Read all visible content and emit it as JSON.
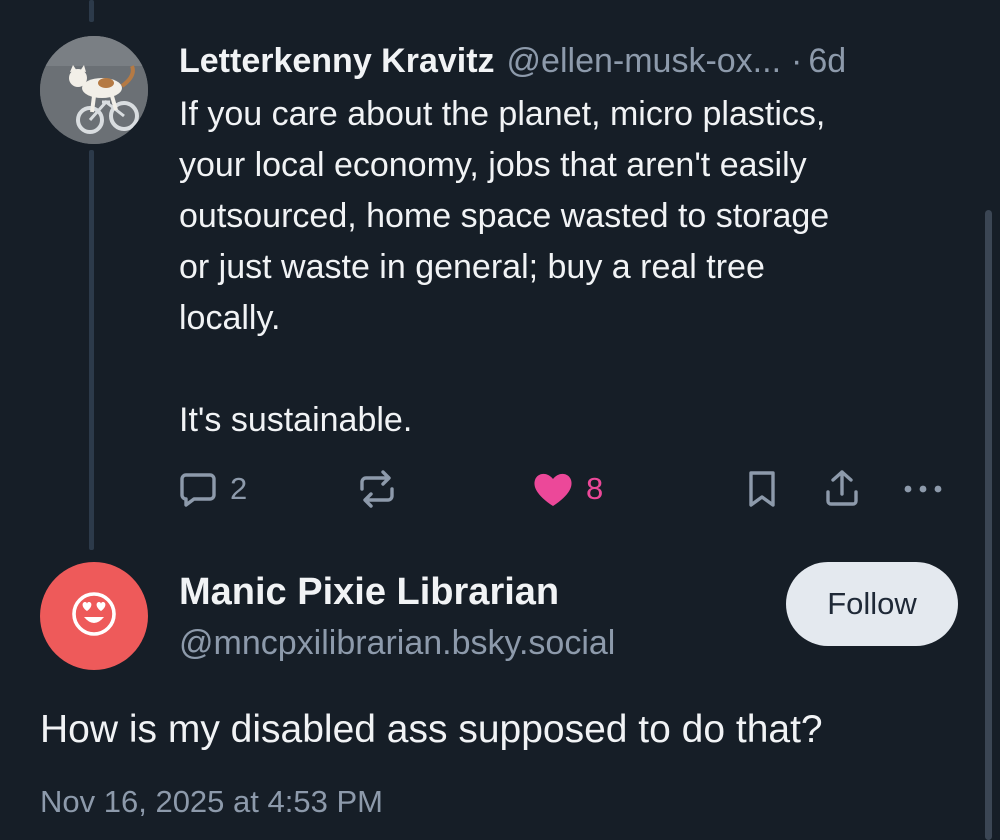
{
  "parent_post": {
    "author_name": "Letterkenny Kravitz",
    "author_handle": "@ellen-musk-ox...",
    "separator": "·",
    "time": "6d",
    "text": "If you care about the planet, micro plastics,\nyour local economy, jobs that aren't easily\noutsourced, home space wasted to storage\nor just waste in general; buy a real tree\nlocally.\n\nIt's sustainable.",
    "avatar_icon": "cat-on-bicycle-photo",
    "actions": {
      "reply_count": "2",
      "like_count": "8",
      "reply_icon": "comment-bubble-icon",
      "repost_icon": "repost-icon",
      "like_icon": "heart-icon",
      "bookmark_icon": "bookmark-icon",
      "share_icon": "share-icon",
      "more_icon": "more-dots-icon"
    }
  },
  "reply_post": {
    "author_name": "Manic Pixie Librarian",
    "author_handle": "@mncpxilibrarian.bsky.social",
    "follow_label": "Follow",
    "text": "How is my disabled ass supposed to do that?",
    "date": "Nov 16, 2025 at 4:53 PM",
    "avatar_icon": "heart-eyes-emoji-icon"
  },
  "colors": {
    "background": "#161e27",
    "primary_text": "#f1f3f5",
    "secondary_text": "#8d9aab",
    "like_pink": "#ec4899",
    "thread_line": "#2c3a4a",
    "avatar_red": "#ee5a5a",
    "follow_bg": "#e4e9ef"
  }
}
